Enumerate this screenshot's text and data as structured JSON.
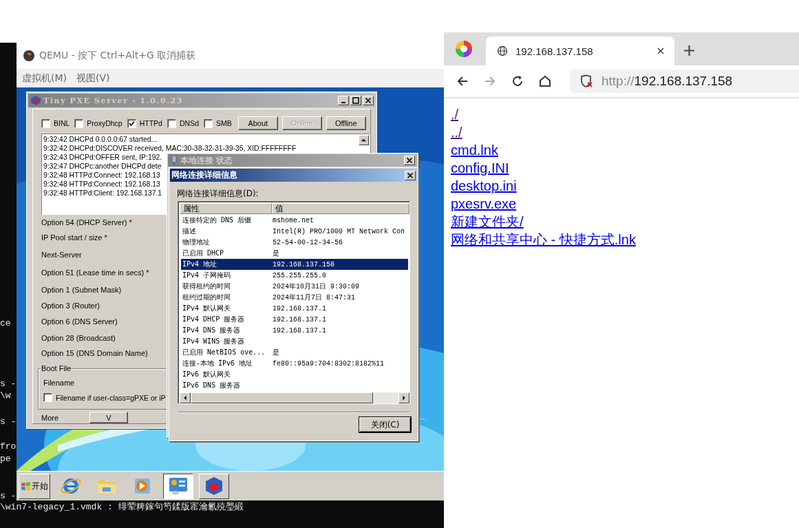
{
  "terminal": {
    "lines": [
      "ce",
      "s -",
      "\\w",
      "s -",
      "fro",
      "pe",
      "s -",
      "\\win7-legacy_1.vmdk :  绯荤粺鎵句笉鍒版寚瀹氱殑璺緞"
    ]
  },
  "qemu": {
    "title": "QEMU - 按下 Ctrl+Alt+G 取消捕获",
    "menu": [
      "虚拟机(M)",
      "视图(V)"
    ],
    "pxe_window": {
      "title": "Tiny PXE Server - 1.0.0.23",
      "options": [
        {
          "label": "BINL",
          "checked": false
        },
        {
          "label": "ProxyDhcp",
          "checked": false
        },
        {
          "label": "HTTPd",
          "checked": true
        },
        {
          "label": "DNSd",
          "checked": false
        },
        {
          "label": "SMB",
          "checked": false
        }
      ],
      "buttons": [
        {
          "label": "About",
          "disabled": false
        },
        {
          "label": "Online",
          "disabled": true
        },
        {
          "label": "Offline",
          "disabled": false
        }
      ],
      "log": [
        "9:32:42 DHCPd 0.0.0.0:67 started...",
        "9:32:42 DHCPd:DISCOVER received, MAC:30-38-32-31-39-35, XID:FFFFFFFF",
        "9:32:43 DHCPd:OFFER sent, IP:192.",
        "9:32:47 DHCPc:another DHCPd dete",
        "9:32:48 HTTPd:Connect: 192.168.13",
        "9:32:48 HTTPd:Connect: 192.168.13",
        "9:32:48 HTTPd:Client: 192.168.137.1"
      ],
      "fields": [
        "Option 54 (DHCP Server) *",
        "IP Pool start / size *",
        "Next-Server",
        "Option 51 (Lease time in secs) *",
        "Option 1  (Subnet Mask)",
        "Option 3  (Router)",
        "Option 6  (DNS Server)",
        "Option 28 (Broadcast)",
        "Option 15 (DNS Domain Name)"
      ],
      "boot_file": {
        "title": "Boot File",
        "filename_label": "Filename",
        "user_class": {
          "label": "Filename if user-class=gPXE or iP",
          "checked": false
        }
      },
      "more": {
        "label": "More",
        "button": "V"
      }
    },
    "status_window": {
      "title": "本地连接 状态"
    },
    "details_dialog": {
      "title": "网络连接详细信息",
      "list_label": "网络连接详细信息(D):",
      "columns": [
        "属性",
        "值"
      ],
      "rows": [
        {
          "property": "连接特定的 DNS 后缀",
          "value": "mshome.net",
          "selected": false
        },
        {
          "property": "描述",
          "value": "Intel(R) PRO/1000 MT Network Con",
          "selected": false
        },
        {
          "property": "物理地址",
          "value": "52-54-00-12-34-56",
          "selected": false
        },
        {
          "property": "已启用 DHCP",
          "value": "是",
          "selected": false
        },
        {
          "property": "IPv4 地址",
          "value": "192.168.137.158",
          "selected": true
        },
        {
          "property": "IPv4 子网掩码",
          "value": "255.255.255.0",
          "selected": false
        },
        {
          "property": "获得租约的时间",
          "value": "2024年10月31日 9:30:09",
          "selected": false
        },
        {
          "property": "租约过期的时间",
          "value": "2024年11月7日 8:47:31",
          "selected": false
        },
        {
          "property": "IPv4 默认网关",
          "value": "192.168.137.1",
          "selected": false
        },
        {
          "property": "IPv4 DHCP 服务器",
          "value": "192.168.137.1",
          "selected": false
        },
        {
          "property": "IPv4 DNS 服务器",
          "value": "192.168.137.1",
          "selected": false
        },
        {
          "property": "IPv4 WINS 服务器",
          "selected": false
        },
        {
          "property": "已启用 NetBIOS ove...",
          "value": "是",
          "selected": false
        },
        {
          "property": "连接-本地 IPv6 地址",
          "value": "fe80::95a9:704:8302:8182%11",
          "selected": false
        },
        {
          "property": "IPv6 默认网关",
          "selected": false
        },
        {
          "property": "IPv6 DNS 服务器",
          "selected": false
        }
      ],
      "close_button": "关闭(C)"
    },
    "taskbar": {
      "start": "开始",
      "apps": [
        {
          "kind": "browser",
          "pressed": false
        },
        {
          "kind": "folder",
          "pressed": false
        },
        {
          "kind": "media",
          "pressed": false
        },
        {
          "kind": "panel",
          "pressed": true
        },
        {
          "kind": "cube",
          "pressed": false
        }
      ]
    }
  },
  "browser": {
    "tab": {
      "title": "192.168.137.158"
    },
    "address": {
      "scheme": "http://",
      "host": "192.168.137.158"
    },
    "links": [
      {
        "text": "./",
        "visited": true
      },
      {
        "text": "../",
        "visited": true
      },
      {
        "text": "cmd.lnk",
        "visited": false
      },
      {
        "text": "config.INI",
        "visited": false
      },
      {
        "text": "desktop.ini",
        "visited": false
      },
      {
        "text": "pxesrv.exe",
        "visited": false
      },
      {
        "text": "新建文件夹/",
        "visited": false
      },
      {
        "text": "网络和共享中心 - 快捷方式.lnk",
        "visited": false
      }
    ]
  }
}
